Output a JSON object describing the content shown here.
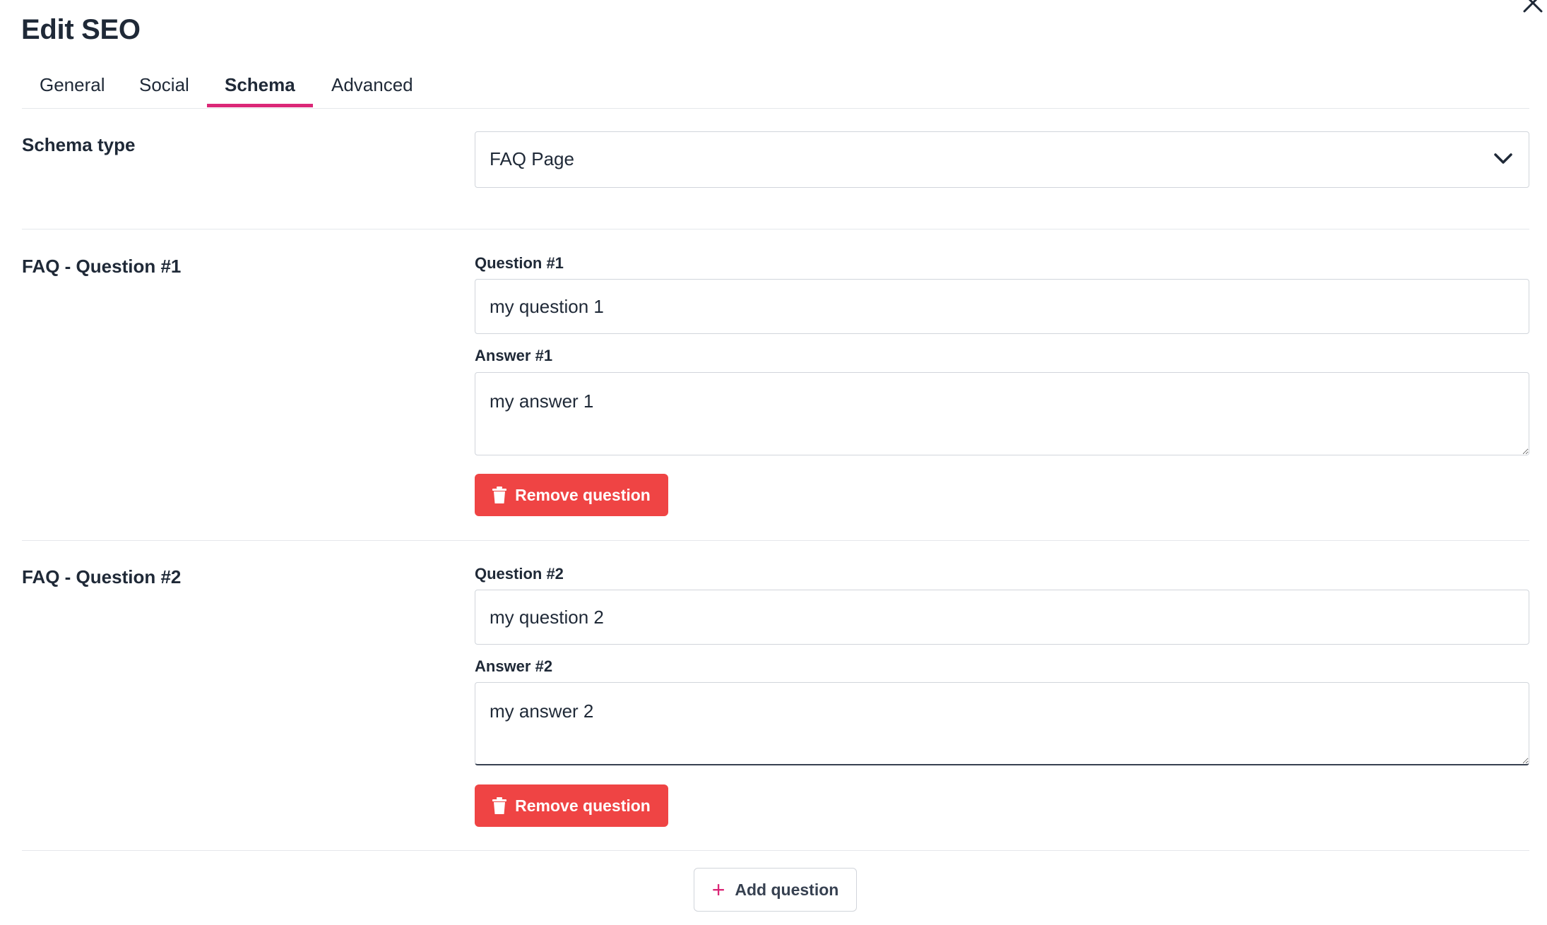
{
  "dialog": {
    "title": "Edit SEO"
  },
  "tabs": [
    {
      "label": "General",
      "active": false
    },
    {
      "label": "Social",
      "active": false
    },
    {
      "label": "Schema",
      "active": true
    },
    {
      "label": "Advanced",
      "active": false
    }
  ],
  "schema_type": {
    "label": "Schema type",
    "selected": "FAQ Page"
  },
  "faq": [
    {
      "section_label": "FAQ - Question #1",
      "question_label": "Question #1",
      "question_value": "my question 1",
      "answer_label": "Answer #1",
      "answer_value": "my answer 1",
      "remove_label": "Remove question"
    },
    {
      "section_label": "FAQ - Question #2",
      "question_label": "Question #2",
      "question_value": "my question 2",
      "answer_label": "Answer #2",
      "answer_value": "my answer 2",
      "remove_label": "Remove question"
    }
  ],
  "add_button": {
    "label": "Add question"
  },
  "colors": {
    "accent": "#db2777",
    "danger": "#ef4444",
    "border": "#d1d5db",
    "text": "#1f2937"
  },
  "icons": {
    "close": "close-icon",
    "dropdown": "chevron-down-icon",
    "remove": "trash-icon",
    "add": "plus-icon"
  }
}
